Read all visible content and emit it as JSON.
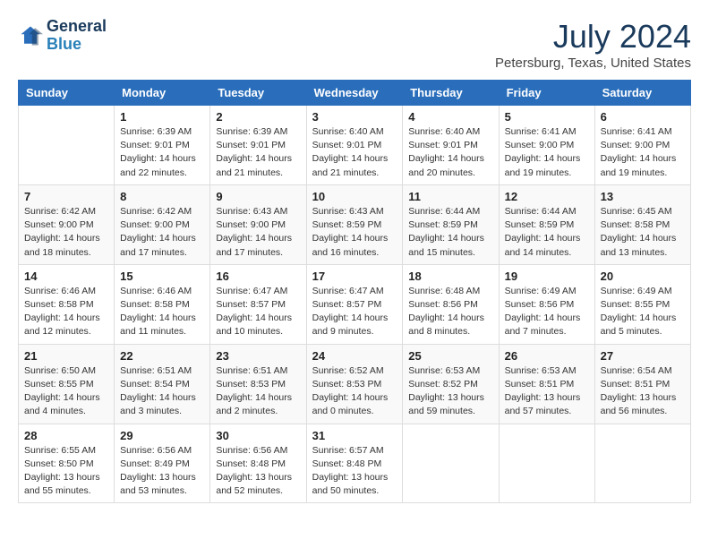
{
  "logo": {
    "line1": "General",
    "line2": "Blue"
  },
  "title": {
    "month_year": "July 2024",
    "location": "Petersburg, Texas, United States"
  },
  "days_of_week": [
    "Sunday",
    "Monday",
    "Tuesday",
    "Wednesday",
    "Thursday",
    "Friday",
    "Saturday"
  ],
  "weeks": [
    [
      {
        "num": "",
        "info": ""
      },
      {
        "num": "1",
        "info": "Sunrise: 6:39 AM\nSunset: 9:01 PM\nDaylight: 14 hours\nand 22 minutes."
      },
      {
        "num": "2",
        "info": "Sunrise: 6:39 AM\nSunset: 9:01 PM\nDaylight: 14 hours\nand 21 minutes."
      },
      {
        "num": "3",
        "info": "Sunrise: 6:40 AM\nSunset: 9:01 PM\nDaylight: 14 hours\nand 21 minutes."
      },
      {
        "num": "4",
        "info": "Sunrise: 6:40 AM\nSunset: 9:01 PM\nDaylight: 14 hours\nand 20 minutes."
      },
      {
        "num": "5",
        "info": "Sunrise: 6:41 AM\nSunset: 9:00 PM\nDaylight: 14 hours\nand 19 minutes."
      },
      {
        "num": "6",
        "info": "Sunrise: 6:41 AM\nSunset: 9:00 PM\nDaylight: 14 hours\nand 19 minutes."
      }
    ],
    [
      {
        "num": "7",
        "info": "Sunrise: 6:42 AM\nSunset: 9:00 PM\nDaylight: 14 hours\nand 18 minutes."
      },
      {
        "num": "8",
        "info": "Sunrise: 6:42 AM\nSunset: 9:00 PM\nDaylight: 14 hours\nand 17 minutes."
      },
      {
        "num": "9",
        "info": "Sunrise: 6:43 AM\nSunset: 9:00 PM\nDaylight: 14 hours\nand 17 minutes."
      },
      {
        "num": "10",
        "info": "Sunrise: 6:43 AM\nSunset: 8:59 PM\nDaylight: 14 hours\nand 16 minutes."
      },
      {
        "num": "11",
        "info": "Sunrise: 6:44 AM\nSunset: 8:59 PM\nDaylight: 14 hours\nand 15 minutes."
      },
      {
        "num": "12",
        "info": "Sunrise: 6:44 AM\nSunset: 8:59 PM\nDaylight: 14 hours\nand 14 minutes."
      },
      {
        "num": "13",
        "info": "Sunrise: 6:45 AM\nSunset: 8:58 PM\nDaylight: 14 hours\nand 13 minutes."
      }
    ],
    [
      {
        "num": "14",
        "info": "Sunrise: 6:46 AM\nSunset: 8:58 PM\nDaylight: 14 hours\nand 12 minutes."
      },
      {
        "num": "15",
        "info": "Sunrise: 6:46 AM\nSunset: 8:58 PM\nDaylight: 14 hours\nand 11 minutes."
      },
      {
        "num": "16",
        "info": "Sunrise: 6:47 AM\nSunset: 8:57 PM\nDaylight: 14 hours\nand 10 minutes."
      },
      {
        "num": "17",
        "info": "Sunrise: 6:47 AM\nSunset: 8:57 PM\nDaylight: 14 hours\nand 9 minutes."
      },
      {
        "num": "18",
        "info": "Sunrise: 6:48 AM\nSunset: 8:56 PM\nDaylight: 14 hours\nand 8 minutes."
      },
      {
        "num": "19",
        "info": "Sunrise: 6:49 AM\nSunset: 8:56 PM\nDaylight: 14 hours\nand 7 minutes."
      },
      {
        "num": "20",
        "info": "Sunrise: 6:49 AM\nSunset: 8:55 PM\nDaylight: 14 hours\nand 5 minutes."
      }
    ],
    [
      {
        "num": "21",
        "info": "Sunrise: 6:50 AM\nSunset: 8:55 PM\nDaylight: 14 hours\nand 4 minutes."
      },
      {
        "num": "22",
        "info": "Sunrise: 6:51 AM\nSunset: 8:54 PM\nDaylight: 14 hours\nand 3 minutes."
      },
      {
        "num": "23",
        "info": "Sunrise: 6:51 AM\nSunset: 8:53 PM\nDaylight: 14 hours\nand 2 minutes."
      },
      {
        "num": "24",
        "info": "Sunrise: 6:52 AM\nSunset: 8:53 PM\nDaylight: 14 hours\nand 0 minutes."
      },
      {
        "num": "25",
        "info": "Sunrise: 6:53 AM\nSunset: 8:52 PM\nDaylight: 13 hours\nand 59 minutes."
      },
      {
        "num": "26",
        "info": "Sunrise: 6:53 AM\nSunset: 8:51 PM\nDaylight: 13 hours\nand 57 minutes."
      },
      {
        "num": "27",
        "info": "Sunrise: 6:54 AM\nSunset: 8:51 PM\nDaylight: 13 hours\nand 56 minutes."
      }
    ],
    [
      {
        "num": "28",
        "info": "Sunrise: 6:55 AM\nSunset: 8:50 PM\nDaylight: 13 hours\nand 55 minutes."
      },
      {
        "num": "29",
        "info": "Sunrise: 6:56 AM\nSunset: 8:49 PM\nDaylight: 13 hours\nand 53 minutes."
      },
      {
        "num": "30",
        "info": "Sunrise: 6:56 AM\nSunset: 8:48 PM\nDaylight: 13 hours\nand 52 minutes."
      },
      {
        "num": "31",
        "info": "Sunrise: 6:57 AM\nSunset: 8:48 PM\nDaylight: 13 hours\nand 50 minutes."
      },
      {
        "num": "",
        "info": ""
      },
      {
        "num": "",
        "info": ""
      },
      {
        "num": "",
        "info": ""
      }
    ]
  ]
}
